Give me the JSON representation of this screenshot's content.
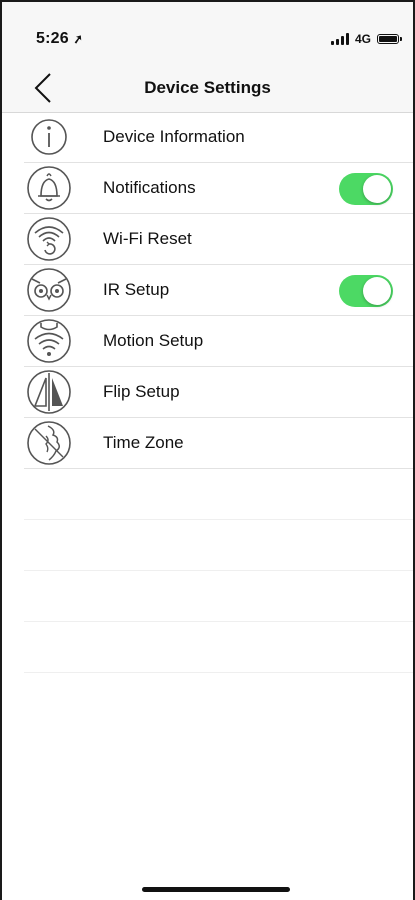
{
  "status_bar": {
    "time": "5:26",
    "location_icon": "location-arrow-icon",
    "network": "4G",
    "signal_icon": "cellular-signal-icon",
    "battery_icon": "battery-icon"
  },
  "nav": {
    "title": "Device Settings",
    "back_icon": "chevron-left-icon"
  },
  "settings": {
    "items": [
      {
        "label": "Device Information",
        "icon": "info-icon"
      },
      {
        "label": "Notifications",
        "icon": "bell-icon",
        "toggle": true
      },
      {
        "label": "Wi-Fi Reset",
        "icon": "wifi-reset-icon"
      },
      {
        "label": "IR Setup",
        "icon": "owl-icon",
        "toggle": true
      },
      {
        "label": "Motion Setup",
        "icon": "motion-icon"
      },
      {
        "label": "Flip Setup",
        "icon": "flip-icon"
      },
      {
        "label": "Time Zone",
        "icon": "globe-icon"
      }
    ]
  },
  "colors": {
    "toggle_on": "#4cd964",
    "icon_stroke": "#555555"
  }
}
